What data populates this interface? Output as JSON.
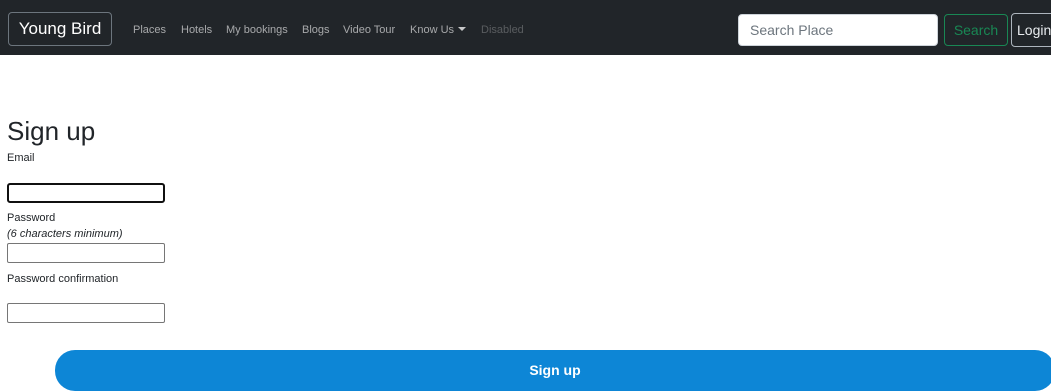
{
  "navbar": {
    "brand": "Young Bird",
    "links": [
      {
        "label": "Places"
      },
      {
        "label": "Hotels"
      },
      {
        "label": "My bookings"
      },
      {
        "label": "Blogs"
      },
      {
        "label": "Video Tour"
      },
      {
        "label": "Know Us",
        "dropdown": true
      },
      {
        "label": "Disabled",
        "disabled": true
      }
    ],
    "search_placeholder": "Search Place",
    "search_button": "Search",
    "login_button": "Login"
  },
  "form": {
    "title": "Sign up",
    "email_label": "Email",
    "email_value": "",
    "password_label": "Password",
    "password_hint": "(6 characters minimum)",
    "password_value": "",
    "confirmation_label": "Password confirmation",
    "confirmation_value": "",
    "submit_label": "Sign up"
  },
  "colors": {
    "navbar_bg": "#212529",
    "search_accent": "#198754",
    "submit_bg": "#0d86d6"
  }
}
